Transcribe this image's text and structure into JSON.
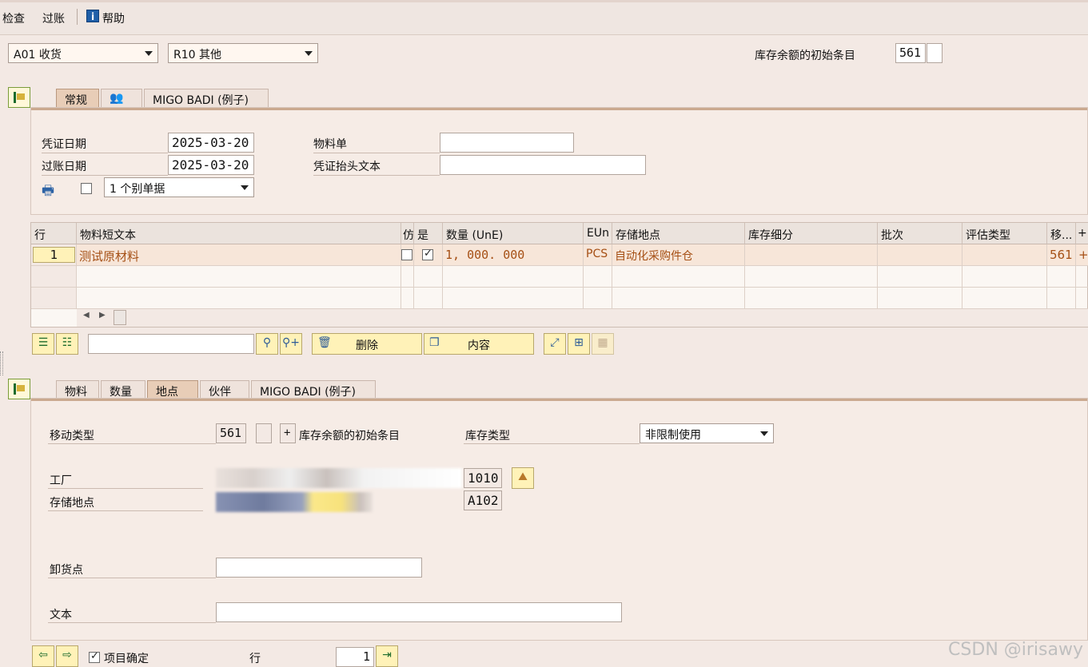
{
  "menubar": {
    "check": "检查",
    "post": "过账",
    "help": "帮助"
  },
  "header": {
    "transaction": "A01 收货",
    "reference": "R10 其他",
    "movement_label": "库存余额的初始条目",
    "movement_type": "561"
  },
  "top_tabs": {
    "general": "常规",
    "migo_badi": "MIGO BADI (例子)"
  },
  "general": {
    "doc_date_label": "凭证日期",
    "doc_date": "2025-03-20",
    "posting_date_label": "过账日期",
    "posting_date": "2025-03-20",
    "material_slip_label": "物料单",
    "material_slip": "",
    "header_text_label": "凭证抬头文本",
    "header_text": "",
    "slip_option": "1 个别单据"
  },
  "grid": {
    "headers": [
      "行",
      "物料短文本",
      "仿",
      "是",
      "数量 (UnE)",
      "EUn",
      "存储地点",
      "库存细分",
      "批次",
      "评估类型",
      "移...",
      "+"
    ],
    "row": {
      "line": "1",
      "text": "测试原材料",
      "qty": "1, 000. 000",
      "unit": "PCS",
      "sloc": "自动化采购件仓",
      "mvt": "561",
      "sign": "+"
    }
  },
  "toolbar": {
    "delete": "删除",
    "contents": "内容",
    "search_value": ""
  },
  "detail_tabs": {
    "material": "物料",
    "quantity": "数量",
    "where": "地点",
    "partner": "伙伴",
    "migo_badi": "MIGO BADI (例子)"
  },
  "detail": {
    "mvt_label": "移动类型",
    "mvt": "561",
    "mvt_sign": "+",
    "mvt_text": "库存余额的初始条目",
    "stock_type_label": "库存类型",
    "stock_type": "非限制使用",
    "plant_label": "工厂",
    "plant": "1010",
    "sloc_label": "存储地点",
    "sloc": "A102",
    "unloading_label": "卸货点",
    "text_label": "文本"
  },
  "footer": {
    "item_ok": "项目确定",
    "line_label": "行",
    "line": "1"
  },
  "watermark": "CSDN @irisawy"
}
